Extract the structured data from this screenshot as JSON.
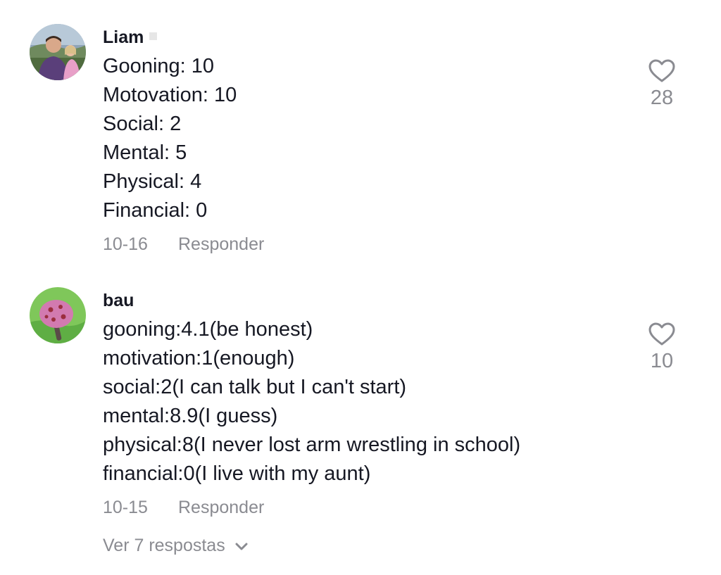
{
  "comments": [
    {
      "username": "Liam",
      "lines": [
        "Gooning: 10",
        "Motovation: 10",
        "Social: 2",
        "Mental: 5",
        "Physical: 4",
        "Financial: 0"
      ],
      "date": "10-16",
      "reply_label": "Responder",
      "likes": "28",
      "avatar_icon": "user-photo-avatar",
      "like_icon": "heart-outline-icon"
    },
    {
      "username": "bau",
      "lines": [
        "gooning:4.1(be honest)",
        "motivation:1(enough)",
        "social:2(I can talk but I can't start)",
        "mental:8.9(I guess)",
        "physical:8(I never lost arm wrestling in school)",
        "financial:0(I live with my aunt)"
      ],
      "date": "10-15",
      "reply_label": "Responder",
      "likes": "10",
      "avatar_icon": "mushroom-avatar",
      "like_icon": "heart-outline-icon"
    }
  ],
  "view_replies": {
    "label": "Ver 7 respostas",
    "icon": "chevron-down-icon"
  },
  "colors": {
    "primary_text": "#161823",
    "secondary_text": "#8a8b91",
    "background": "#ffffff"
  }
}
